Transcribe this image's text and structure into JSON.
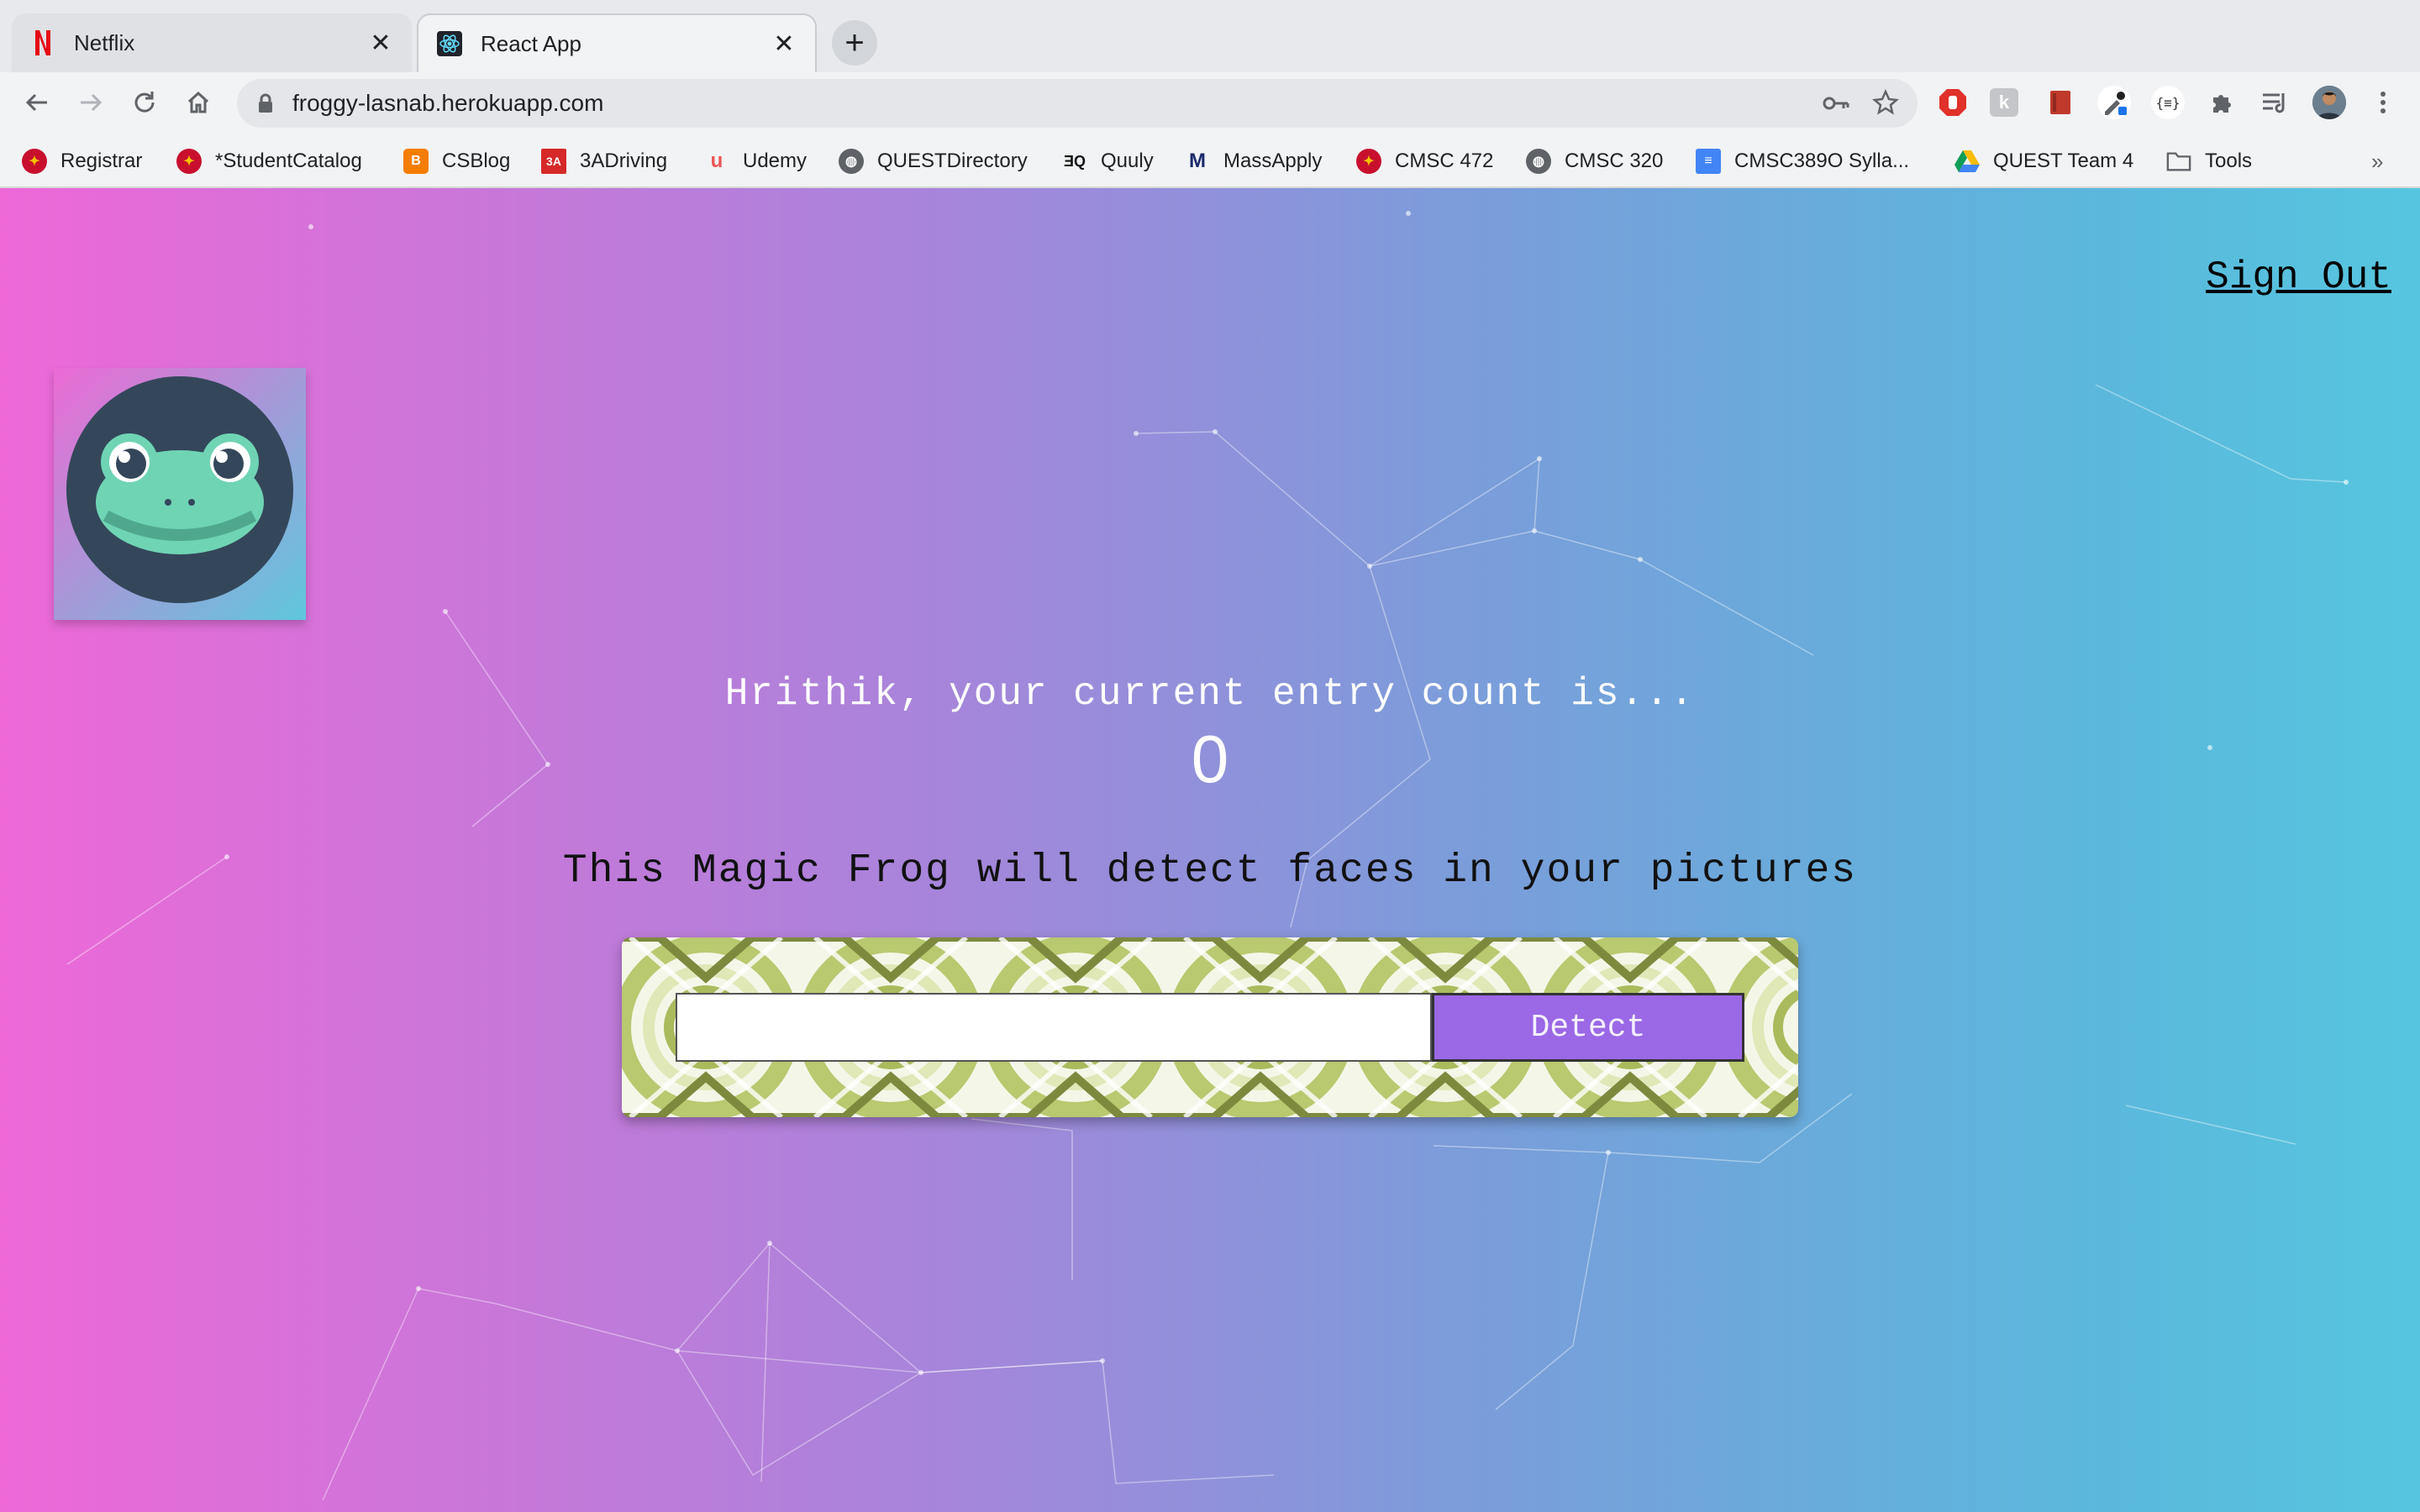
{
  "browser": {
    "tabs": [
      {
        "title": "Netflix",
        "active": false
      },
      {
        "title": "React App",
        "active": true
      }
    ],
    "url": "froggy-lasnab.herokuapp.com",
    "bookmarks": [
      {
        "label": "Registrar"
      },
      {
        "label": "*StudentCatalog"
      },
      {
        "label": "CSBlog"
      },
      {
        "label": "3ADriving"
      },
      {
        "label": "Udemy"
      },
      {
        "label": "QUESTDirectory"
      },
      {
        "label": "Quuly"
      },
      {
        "label": "MassApply"
      },
      {
        "label": "CMSC 472"
      },
      {
        "label": "CMSC 320"
      },
      {
        "label": "CMSC389O Sylla..."
      },
      {
        "label": "QUEST Team 4"
      },
      {
        "label": "Tools"
      }
    ],
    "overflow": "»"
  },
  "app": {
    "sign_out": "Sign Out",
    "count_label": "Hrithik, your current entry count is...",
    "count": "0",
    "subtitle": "This Magic Frog will detect faces in your pictures",
    "input_value": "",
    "detect_label": "Detect"
  },
  "colors": {
    "gradient_left": "#ee68d8",
    "gradient_right": "#56c6df",
    "detect_button": "#9b68e6",
    "frog_dark": "#34475a",
    "frog_green": "#6fd4b4"
  }
}
